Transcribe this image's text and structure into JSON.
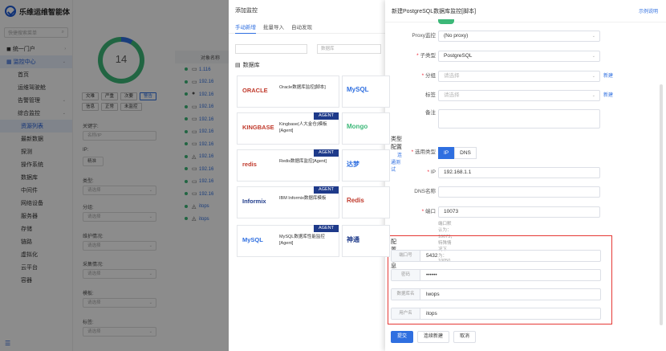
{
  "app": {
    "name": "乐维运维智能体",
    "search_placeholder": "快捷搜索菜单",
    "nav": [
      {
        "label": "统一门户",
        "type": "group"
      },
      {
        "label": "监控中心",
        "type": "active"
      },
      {
        "label": "首页",
        "type": "sub"
      },
      {
        "label": "运维驾驶舱",
        "type": "sub"
      },
      {
        "label": "告警管理",
        "type": "group2"
      },
      {
        "label": "综合监控",
        "type": "group2"
      },
      {
        "label": "资源列表",
        "type": "sel"
      },
      {
        "label": "最新数据",
        "type": "sub2"
      },
      {
        "label": "探测",
        "type": "sub2"
      },
      {
        "label": "操作系统",
        "type": "sub2"
      },
      {
        "label": "数据库",
        "type": "sub2"
      },
      {
        "label": "中间件",
        "type": "sub2"
      },
      {
        "label": "网络设备",
        "type": "sub2"
      },
      {
        "label": "服务器",
        "type": "sub2"
      },
      {
        "label": "存储",
        "type": "sub2"
      },
      {
        "label": "链路",
        "type": "sub2"
      },
      {
        "label": "虚拟化",
        "type": "sub2"
      },
      {
        "label": "云平台",
        "type": "sub2"
      },
      {
        "label": "容器",
        "type": "sub2"
      }
    ],
    "footer_icon": "collapse-icon"
  },
  "filter": {
    "total": "14",
    "chips": [
      "灾难",
      "严重",
      "次要",
      "警告",
      "信息",
      "正常",
      "未监控"
    ],
    "keyword_label": "关键字:",
    "keyword_placeholder": "名称/IP",
    "ip_label": "IP:",
    "ip_value": "精准",
    "type_label": "类型:",
    "group_label": "分组:",
    "maint_label": "维护情况:",
    "collect_label": "采集情况:",
    "tag_label": "标签:",
    "other_label": "模板:",
    "select_placeholder": "请选择"
  },
  "table": {
    "header": "对象名称",
    "rows": [
      "1.116",
      "192.16",
      "192.16",
      "192.16",
      "192.16",
      "192.16",
      "192.16",
      "192.16",
      "192.16",
      "192.16",
      "192.16",
      "itops",
      "itops"
    ]
  },
  "add_panel": {
    "title": "添加监控",
    "tabs": [
      "手动新增",
      "批量导入",
      "自动发现"
    ],
    "search_placeholder": "",
    "search2_placeholder": "数据库",
    "section": "数据库",
    "cards": [
      {
        "logo": "ORACLE",
        "name": "Oracle数据库监控[脚本]",
        "agent": ""
      },
      {
        "logo": "KINGBASE",
        "name": "Kingbase(人大金仓)模板[Agent]",
        "agent": "AGENT"
      },
      {
        "logo": "redis",
        "name": "Redis数据库监控[Agent]",
        "agent": "AGENT"
      },
      {
        "logo": "Informix",
        "name": "IBM Informix数据库模板",
        "agent": "AGENT"
      },
      {
        "logo": "MySQL",
        "name": "MySQL数据库性能监控[Agent]",
        "agent": "AGENT"
      }
    ],
    "cards_right": [
      "MySQL",
      "Mongo",
      "达梦",
      "Redis",
      "神通"
    ]
  },
  "form": {
    "title": "新建PostgreSQL数据库监控[脚本]",
    "help": "示例说明",
    "proxy_label": "Proxy监控",
    "proxy_value": "(No proxy)",
    "subtype_label": "子类型",
    "subtype_value": "PostgreSQL",
    "group_label": "分组",
    "group_placeholder": "请选择",
    "group_new": "新建",
    "tag_label": "标签",
    "tag_placeholder": "请选择",
    "tag_new": "新建",
    "remark_label": "备注",
    "probe_section": "类型配置",
    "probe_link": "连通测试",
    "addr_type_label": "选用类型",
    "addr_types": [
      "IP",
      "DNS"
    ],
    "ip_label": "IP",
    "ip_value": "192.168.1.1",
    "dns_label": "DNS名称",
    "dns_value": "",
    "port_label": "端口",
    "port_value": "10073",
    "port_hint": "端口默认为：10073，特殊情况下为：10050",
    "config_section": "配置信息",
    "config": [
      {
        "k": "端口号",
        "v": "5432"
      },
      {
        "k": "密码",
        "v": "••••••"
      },
      {
        "k": "数据库名",
        "v": "lwops"
      },
      {
        "k": "用户名",
        "v": "itops"
      }
    ],
    "buttons": {
      "submit": "提交",
      "continue": "连续新建",
      "cancel": "取消"
    },
    "colors": {
      "accent": "#2f6fe0",
      "highlight": "#e53935"
    }
  }
}
